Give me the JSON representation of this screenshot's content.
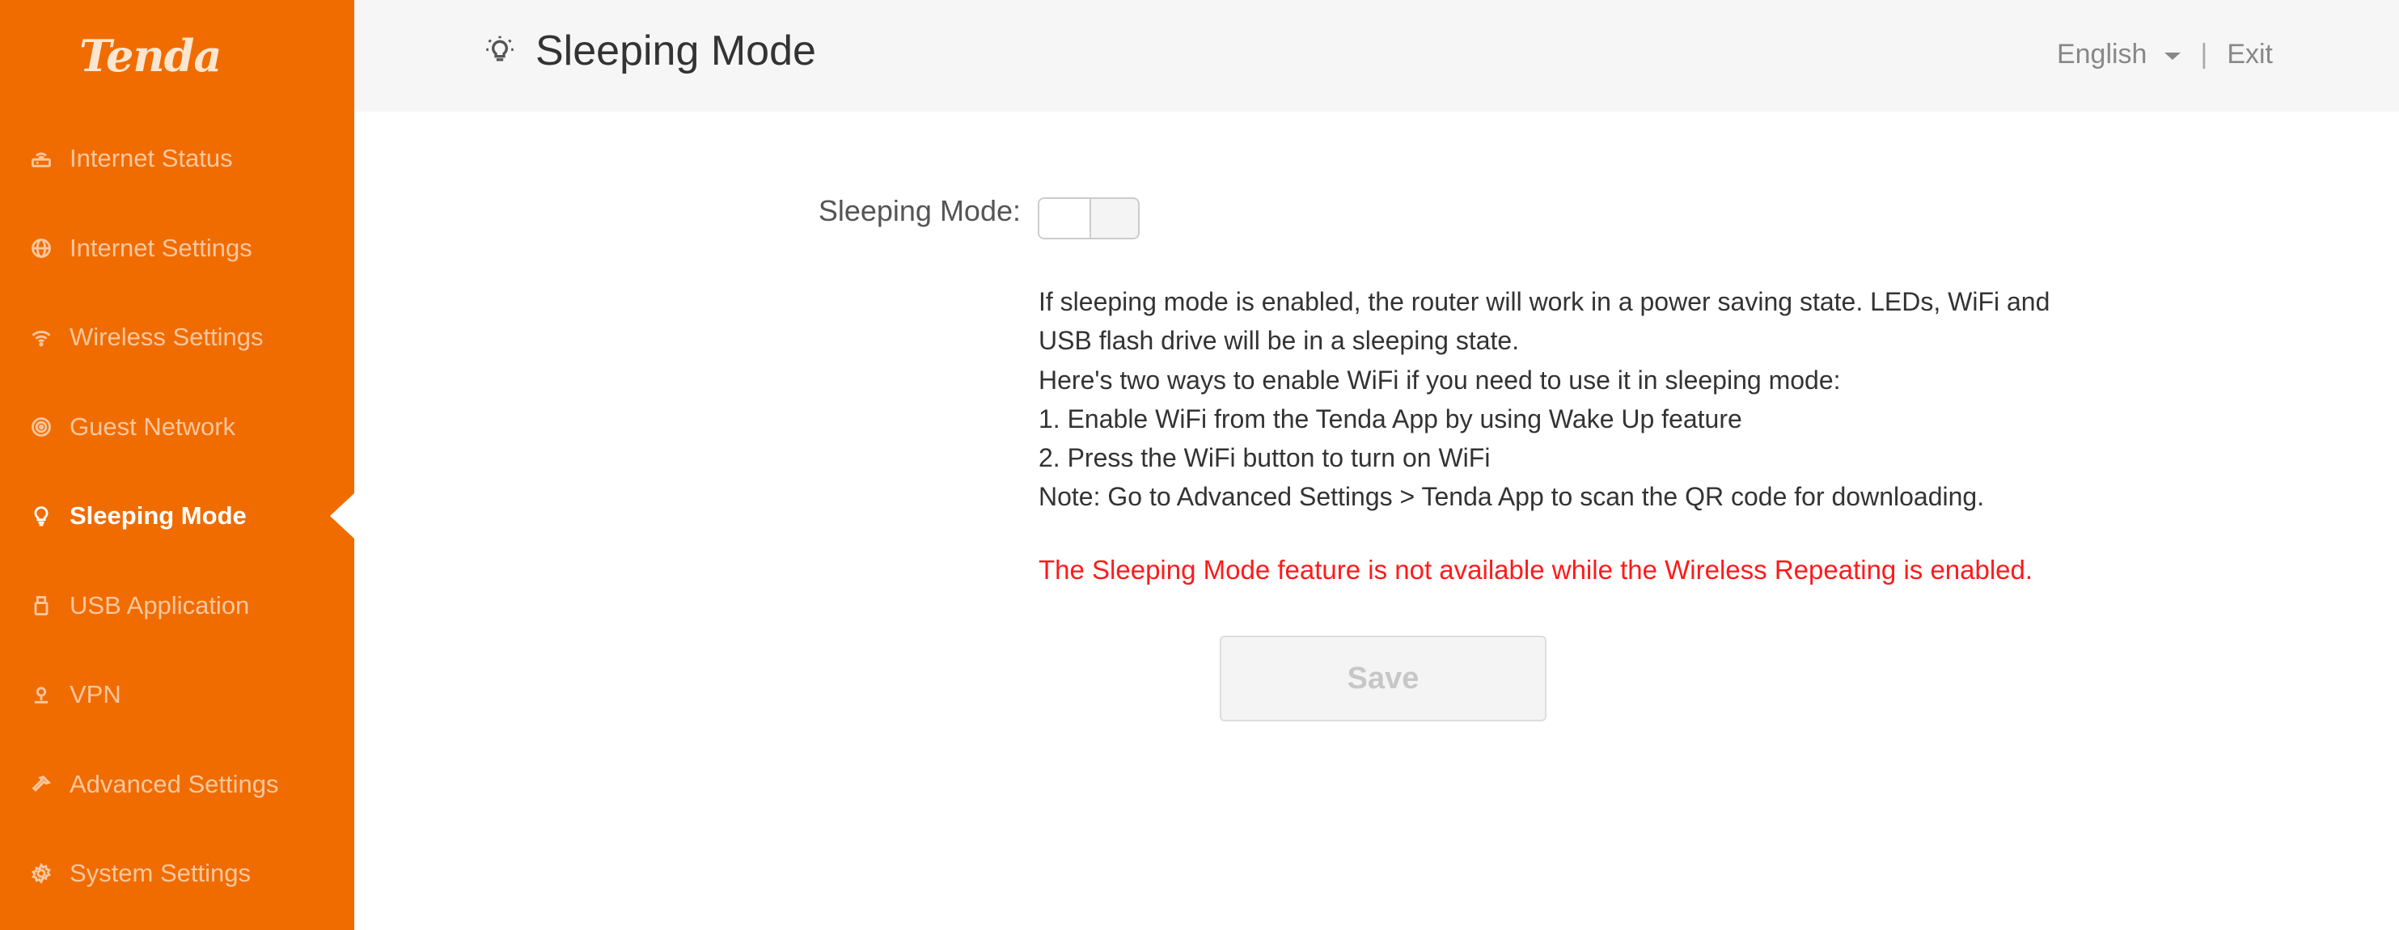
{
  "brand": {
    "logo_text": "Tenda"
  },
  "sidebar": {
    "items": [
      {
        "label": "Internet Status",
        "icon": "router-icon"
      },
      {
        "label": "Internet Settings",
        "icon": "globe-icon"
      },
      {
        "label": "Wireless Settings",
        "icon": "wifi-icon"
      },
      {
        "label": "Guest Network",
        "icon": "guest-network-icon"
      },
      {
        "label": "Sleeping Mode",
        "icon": "lightbulb-icon",
        "active": true
      },
      {
        "label": "USB Application",
        "icon": "usb-icon"
      },
      {
        "label": "VPN",
        "icon": "vpn-icon"
      },
      {
        "label": "Advanced Settings",
        "icon": "wrench-icon"
      },
      {
        "label": "System Settings",
        "icon": "gear-icon"
      }
    ]
  },
  "header": {
    "title": "Sleeping Mode",
    "title_icon": "lightbulb-icon",
    "language": "English",
    "separator": "|",
    "exit_label": "Exit"
  },
  "main": {
    "sleeping_mode_label": "Sleeping Mode:",
    "sleeping_mode_enabled": false,
    "description_lines": [
      "If sleeping mode is enabled, the router will work in a power saving state. LEDs, WiFi and",
      "USB flash drive will be in a sleeping state.",
      "Here's two ways to enable WiFi if you need to use it in sleeping mode:",
      "1. Enable WiFi from the Tenda App by using Wake Up feature",
      "2. Press the WiFi button to turn on WiFi",
      "Note: Go to Advanced Settings > Tenda App to scan the QR code for downloading."
    ],
    "warning": "The Sleeping Mode feature is not available while the Wireless Repeating is enabled.",
    "save_label": "Save"
  },
  "colors": {
    "sidebar_bg": "#f06c00",
    "warning": "#ff1a1a",
    "header_bg": "#f6f6f6"
  }
}
